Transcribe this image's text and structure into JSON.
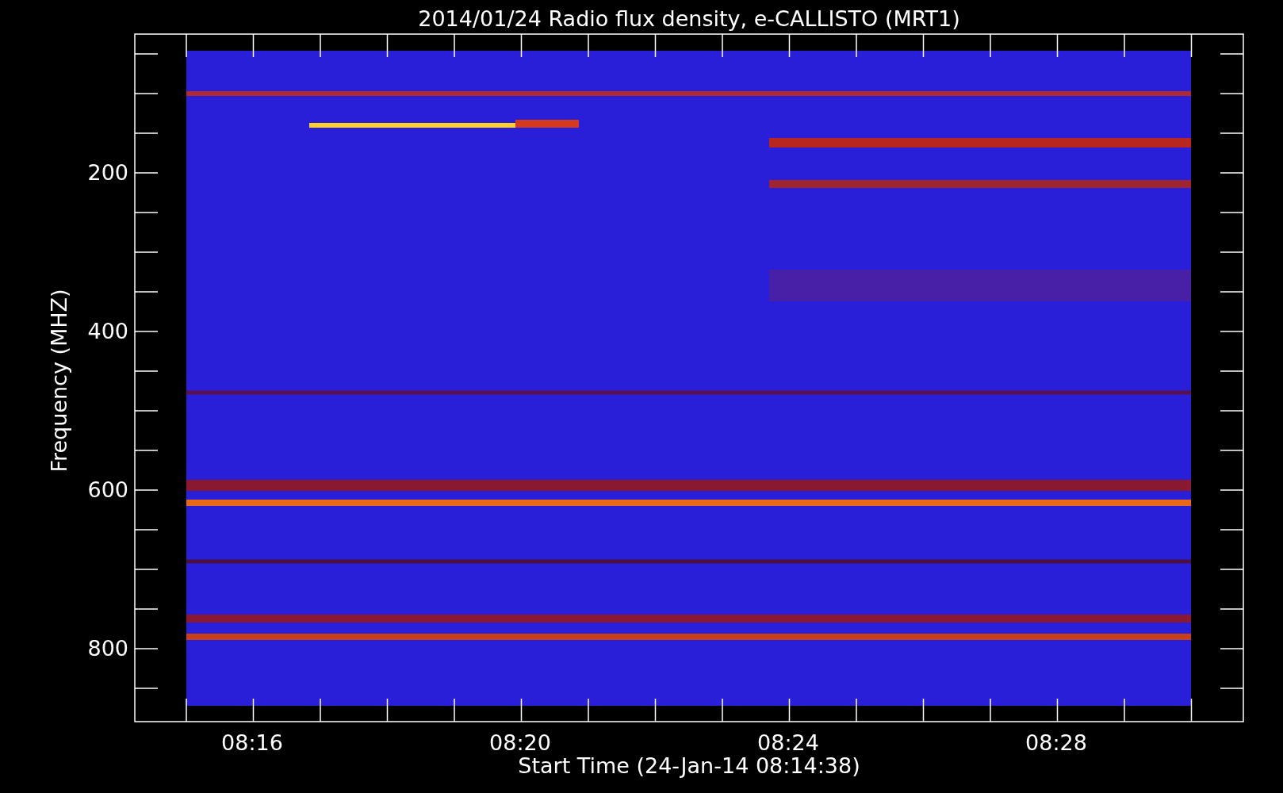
{
  "title": "2014/01/24  Radio flux density, e-CALLISTO (MRT1)",
  "xlabel": "Start Time (24-Jan-14 08:14:38)",
  "ylabel": "Frequency (MHZ)",
  "x_tick_labels": [
    "08:16",
    "08:20",
    "08:24",
    "08:28"
  ],
  "y_tick_labels": [
    "200",
    "400",
    "600",
    "800"
  ]
}
